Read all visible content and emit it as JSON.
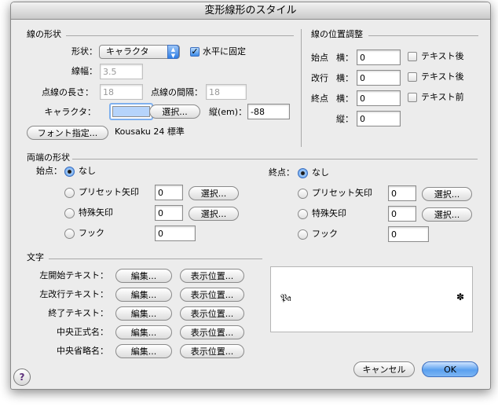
{
  "window": {
    "title": "変形線形のスタイル"
  },
  "line_shape": {
    "header": "線の形状",
    "shape_label": "形状：",
    "shape_value": "キャラクタ",
    "fix_horizontal_label": "水平に固定",
    "fix_horizontal_checked": true,
    "width_label": "線幅：",
    "width_value": "3.5",
    "dash_length_label": "点線の長さ：",
    "dash_length_value": "18",
    "dash_gap_label": "点線の間隔：",
    "dash_gap_value": "18",
    "character_label": "キャラクタ：",
    "select_button": "選択...",
    "vertical_label": "縦(em)：",
    "vertical_value": "-88",
    "font_button": "フォント指定...",
    "font_info": "Kousaku 24 標準"
  },
  "line_position": {
    "header": "線の位置調整",
    "rows": [
      {
        "label": "始点",
        "axis": "横：",
        "value": "0",
        "check_label": "テキスト後",
        "checked": false
      },
      {
        "label": "改行",
        "axis": "横：",
        "value": "0",
        "check_label": "テキスト後",
        "checked": false
      },
      {
        "label": "終点",
        "axis": "横：",
        "value": "0",
        "check_label": "テキスト前",
        "checked": false
      }
    ],
    "vertical_axis": "縦：",
    "vertical_value": "0"
  },
  "ends": {
    "header": "両端の形状",
    "start": {
      "label": "始点：",
      "none_label": "なし",
      "preset_label": "プリセット矢印",
      "preset_value": "0",
      "special_label": "特殊矢印",
      "special_value": "0",
      "hook_label": "フック",
      "hook_value": "0",
      "select_button": "選択..."
    },
    "end": {
      "label": "終点：",
      "none_label": "なし",
      "preset_label": "プリセット矢印",
      "preset_value": "0",
      "special_label": "特殊矢印",
      "special_value": "0",
      "hook_label": "フック",
      "hook_value": "0",
      "select_button": "選択..."
    }
  },
  "text": {
    "header": "文字",
    "edit_button": "編集...",
    "position_button": "表示位置...",
    "rows": [
      {
        "label": "左開始テキスト："
      },
      {
        "label": "左改行テキスト："
      },
      {
        "label": "終了テキスト："
      },
      {
        "label": "中央正式名："
      },
      {
        "label": "中央省略名："
      }
    ]
  },
  "preview": {
    "start_glyph": "𝔓𝔞",
    "end_glyph": "✽"
  },
  "buttons": {
    "cancel": "キャンセル",
    "ok": "OK",
    "help": "?"
  },
  "colors": {
    "accent": "#3b86e3",
    "swatch": "#b6d4fb"
  }
}
